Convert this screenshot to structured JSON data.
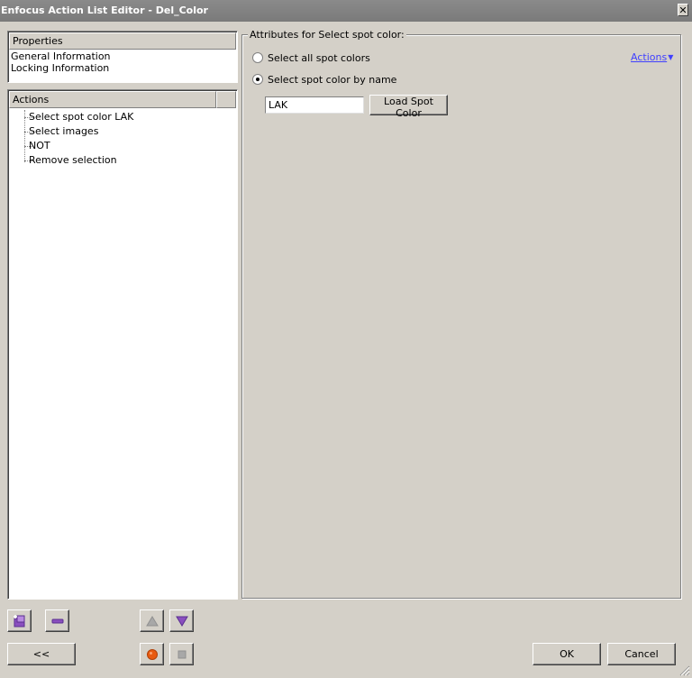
{
  "window": {
    "title": "Enfocus Action List Editor - Del_Color",
    "close_glyph": "✕"
  },
  "properties": {
    "header": "Properties",
    "items": [
      "General Information",
      "Locking Information"
    ]
  },
  "actions_panel": {
    "header": "Actions",
    "items": [
      "Select spot color LAK",
      "Select images",
      "NOT",
      "Remove selection"
    ]
  },
  "attributes": {
    "group_title": "Attributes for Select spot color:",
    "radio_all": "Select all spot colors",
    "radio_by_name": "Select spot color by name",
    "selected_radio": "by_name",
    "actions_link": "Actions",
    "spot_color_value": "LAK",
    "load_button": "Load Spot Color"
  },
  "footer": {
    "collapse_button": "<<",
    "ok_button": "OK",
    "cancel_button": "Cancel"
  },
  "icons": {
    "add": "add-action-icon",
    "remove": "remove-action-icon",
    "up": "move-up-icon",
    "down": "move-down-icon",
    "record": "record-icon",
    "stop": "stop-icon"
  },
  "colors": {
    "dialog_bg": "#d4d0c8",
    "titlebar": "#808080",
    "link": "#4040ff",
    "icon_purple": "#8a4fbf",
    "record_orange": "#e85a10"
  }
}
